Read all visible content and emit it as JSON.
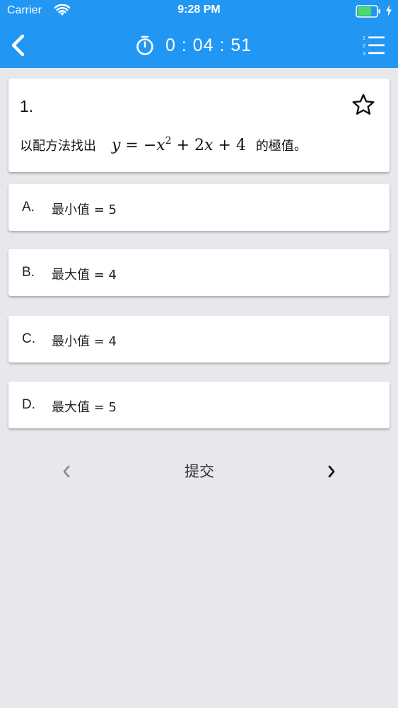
{
  "status_bar": {
    "carrier": "Carrier",
    "time": "9:28 PM"
  },
  "nav": {
    "timer": "0 : 04 : 51",
    "accent_color": "#2196f3"
  },
  "question": {
    "number": "1.",
    "text_before": "以配方法找出",
    "text_after": "的極值。",
    "math": {
      "lhs": "y",
      "eq": " = −",
      "var": "x",
      "exp": "2",
      "mid": " + 2",
      "var2": "x",
      "tail": " + 4"
    }
  },
  "options": [
    {
      "letter": "A.",
      "text": "最小值 = 5"
    },
    {
      "letter": "B.",
      "text": "最大值 = 4"
    },
    {
      "letter": "C.",
      "text": "最小值 = 4"
    },
    {
      "letter": "D.",
      "text": "最大值 = 5"
    }
  ],
  "footer": {
    "submit_label": "提交"
  },
  "icons": [
    "wifi-icon",
    "battery-icon",
    "charging-icon",
    "back-arrow-icon",
    "stopwatch-icon",
    "numbered-list-icon",
    "star-outline-icon",
    "chevron-left-icon",
    "chevron-right-icon"
  ]
}
